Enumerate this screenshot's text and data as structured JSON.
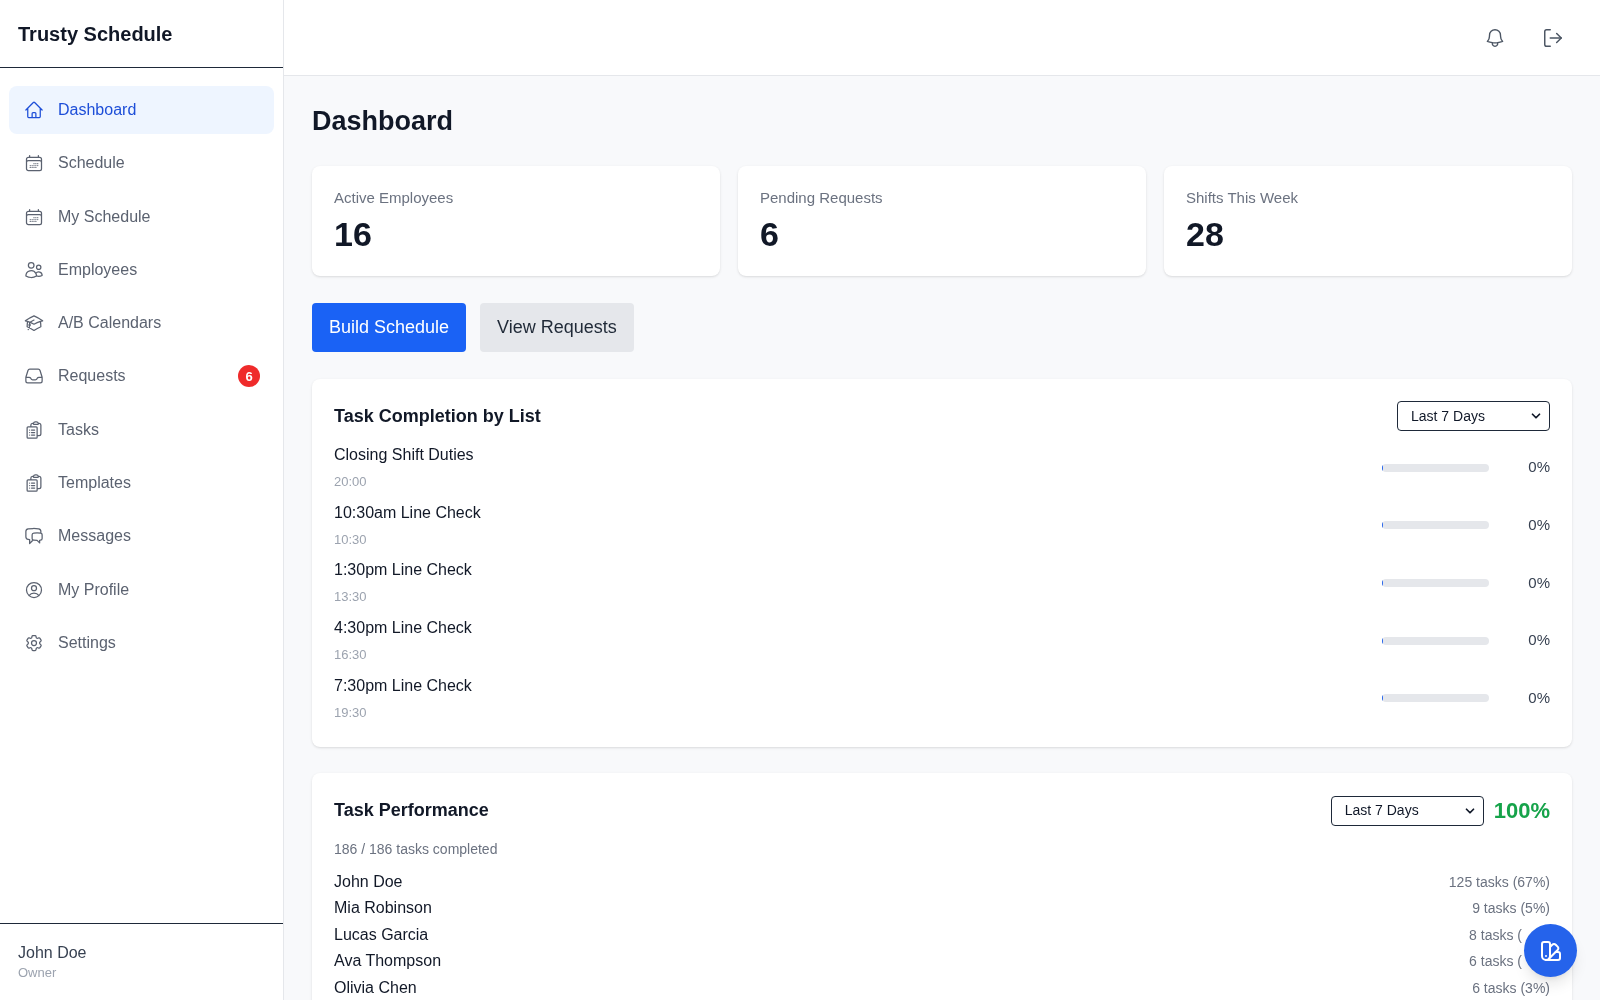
{
  "sidebar": {
    "brand": "Trusty Schedule",
    "items": [
      {
        "label": "Dashboard",
        "selected": true
      },
      {
        "label": "Schedule",
        "selected": false
      },
      {
        "label": "My Schedule",
        "selected": false
      },
      {
        "label": "Employees",
        "selected": false
      },
      {
        "label": "A/B Calendars",
        "selected": false
      },
      {
        "label": "Requests",
        "selected": false,
        "badge": "6"
      },
      {
        "label": "Tasks",
        "selected": false
      },
      {
        "label": "Templates",
        "selected": false
      },
      {
        "label": "Messages",
        "selected": false
      },
      {
        "label": "My Profile",
        "selected": false
      },
      {
        "label": "Settings",
        "selected": false
      }
    ],
    "user": {
      "name": "John Doe",
      "role": "Owner"
    }
  },
  "page_title": "Dashboard",
  "stats": [
    {
      "label": "Active Employees",
      "value": "16"
    },
    {
      "label": "Pending Requests",
      "value": "6"
    },
    {
      "label": "Shifts This Week",
      "value": "28"
    }
  ],
  "actions": [
    {
      "label": "Build Schedule",
      "kind": "primary"
    },
    {
      "label": "View Requests",
      "kind": "secondary"
    }
  ],
  "task_completion": {
    "title": "Task Completion by List",
    "range": "Last 7 Days",
    "lists": [
      {
        "name": "Closing Shift Duties",
        "time": "20:00",
        "level": 0,
        "percent": "0%"
      },
      {
        "name": "10:30am Line Check",
        "time": "10:30",
        "level": 0,
        "percent": "0%"
      },
      {
        "name": "1:30pm Line Check",
        "time": "13:30",
        "level": 0,
        "percent": "0%"
      },
      {
        "name": "4:30pm Line Check",
        "time": "16:30",
        "level": 0,
        "percent": "0%"
      },
      {
        "name": "7:30pm Line Check",
        "time": "19:30",
        "level": 0,
        "percent": "0%"
      }
    ]
  },
  "task_performance": {
    "title": "Task Performance",
    "range": "Last 7 Days",
    "rate": "100%",
    "summary": "186 / 186 tasks completed",
    "people": [
      {
        "name": "John Doe",
        "tasks": "125 tasks (67%)",
        "kind": "plain"
      },
      {
        "name": "Mia Robinson",
        "tasks": "9 tasks (5%)",
        "kind": "plain"
      },
      {
        "name": "Lucas Garcia",
        "tasks": "8 tasks (",
        "kind": "covered"
      },
      {
        "name": "Ava Thompson",
        "tasks": "6 tasks (",
        "kind": "covered"
      },
      {
        "name": "Olivia Chen",
        "tasks": "6 tasks (3%)",
        "kind": "plain"
      }
    ]
  }
}
